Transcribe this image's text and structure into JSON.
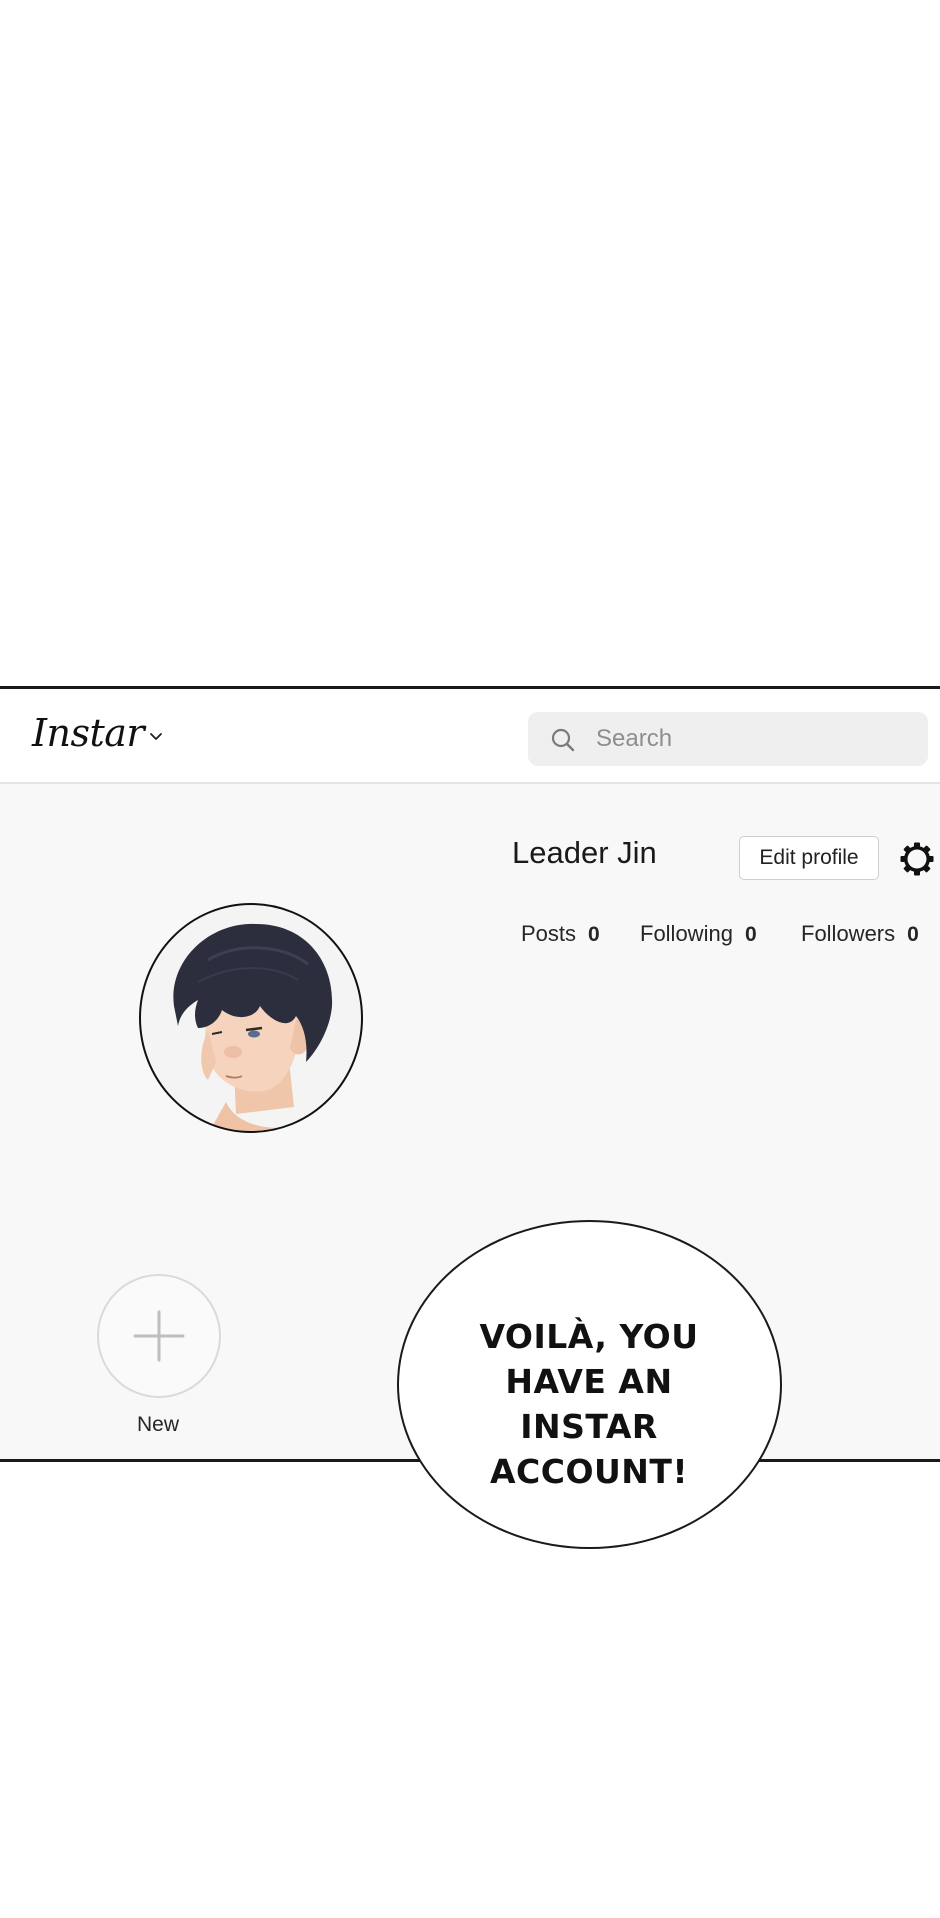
{
  "app": {
    "logo_text": "Instar",
    "search_placeholder": "Search"
  },
  "profile": {
    "username": "Leader Jin",
    "edit_button_label": "Edit profile",
    "stats": [
      {
        "label": "Posts",
        "count": "0"
      },
      {
        "label": "Following",
        "count": "0"
      },
      {
        "label": "Followers",
        "count": "0"
      }
    ]
  },
  "highlights": {
    "new_label": "New"
  },
  "speech_bubble": {
    "lines": [
      "VOILÀ, YOU",
      "HAVE AN INSTAR",
      "ACCOUNT!"
    ]
  },
  "icons": {
    "logo_dropdown": "chevron-down-icon",
    "search": "search-icon",
    "settings": "gear-icon",
    "new_highlight": "plus-icon"
  },
  "colors": {
    "panel_background": "#f8f8f8",
    "search_background": "#efefef",
    "placeholder_text": "#8e8e8e"
  }
}
